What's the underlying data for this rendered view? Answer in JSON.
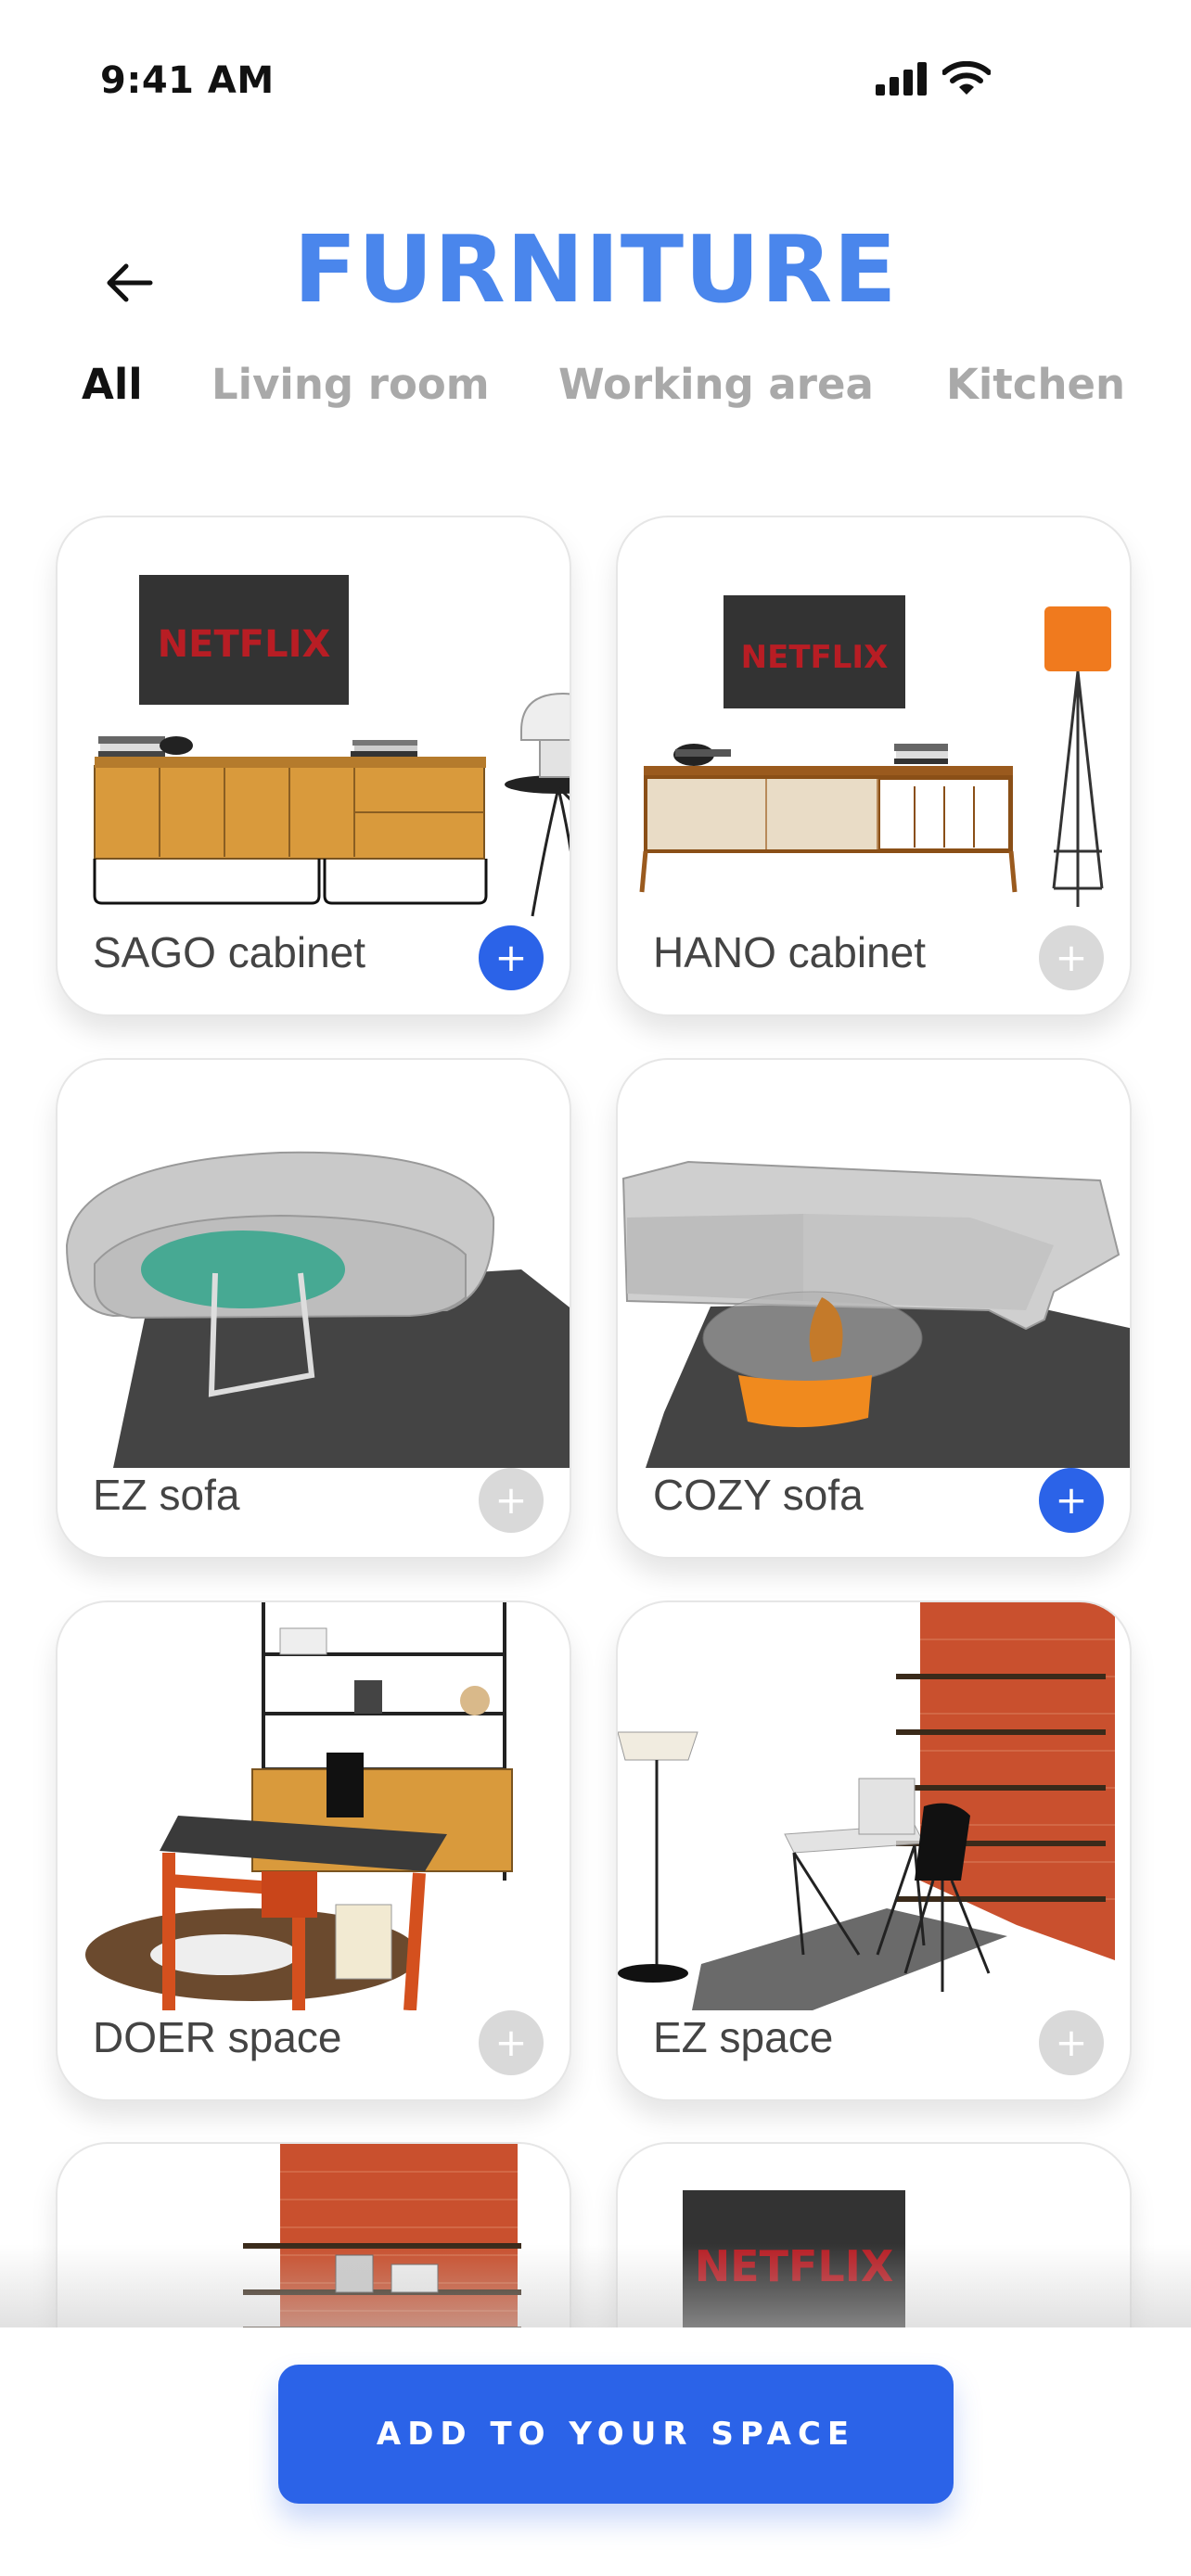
{
  "status_bar": {
    "time": "9:41 AM"
  },
  "header": {
    "title": "FURNITURE",
    "back_icon": "arrow-left-icon"
  },
  "tabs": [
    {
      "label": "All",
      "active": true
    },
    {
      "label": "Living room",
      "active": false
    },
    {
      "label": "Working area",
      "active": false
    },
    {
      "label": "Kitchen",
      "active": false
    }
  ],
  "items": [
    {
      "name": "SAGO cabinet",
      "added": true,
      "screen_text": "NETFLIX"
    },
    {
      "name": "HANO cabinet",
      "added": false,
      "screen_text": "NETFLIX"
    },
    {
      "name": "EZ sofa",
      "added": false
    },
    {
      "name": "COZY sofa",
      "added": true
    },
    {
      "name": "DOER space",
      "added": false
    },
    {
      "name": "EZ space",
      "added": false
    },
    {
      "name": "",
      "added": false
    },
    {
      "name": "",
      "added": false,
      "screen_text": "NETFLIX"
    }
  ],
  "add_glyph": "+",
  "cta": {
    "label": "ADD TO YOUR SPACE"
  },
  "colors": {
    "accent": "#2b63e8",
    "title": "#4a86ec",
    "inactive": "#d9d9d9",
    "netflix_red": "#b81d24"
  }
}
